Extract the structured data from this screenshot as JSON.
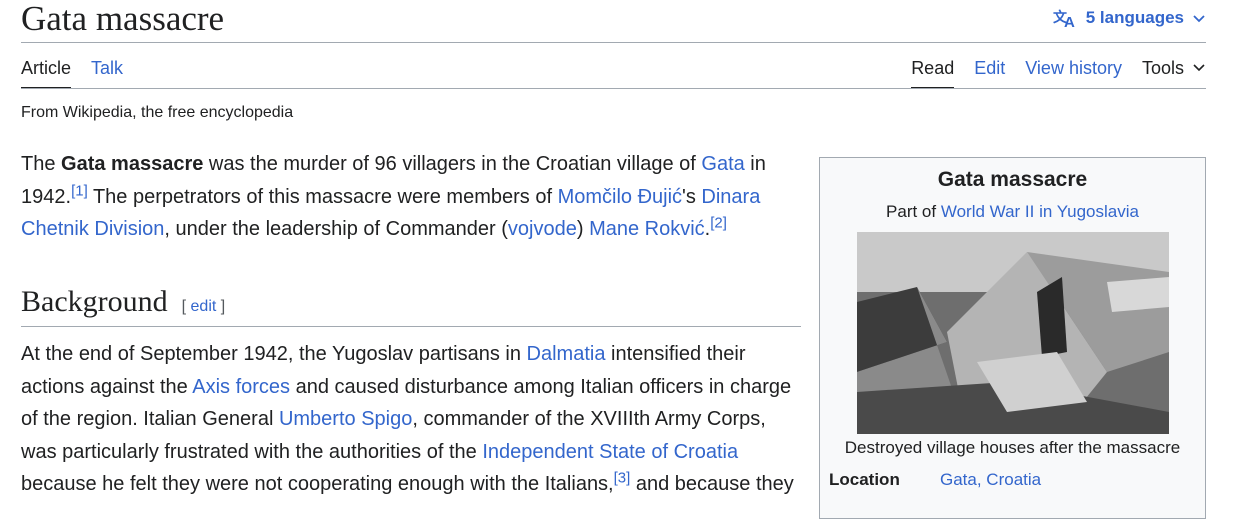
{
  "page": {
    "title": "Gata massacre",
    "languages_label": "5 languages",
    "tagline": "From Wikipedia, the free encyclopedia"
  },
  "tabs": {
    "article": "Article",
    "talk": "Talk",
    "read": "Read",
    "edit": "Edit",
    "view_history": "View history",
    "tools": "Tools"
  },
  "intro": {
    "t1": "The ",
    "bold": "Gata massacre",
    "t2": " was the murder of 96 villagers in the Croatian village of ",
    "link_gata": "Gata",
    "t3": " in 1942.",
    "ref1": "[1]",
    "t4": " The perpetrators of this massacre were members of ",
    "link_djujic": "Momčilo Đujić",
    "t5": "'s ",
    "link_dinara": "Dinara Chetnik Division",
    "t6": ", under the leadership of Commander (",
    "link_vojvode": "vojvode",
    "t7": ") ",
    "link_rokvic": "Mane Rokvić",
    "t8": ".",
    "ref2": "[2]"
  },
  "section": {
    "title": "Background",
    "edit_open": "[ ",
    "edit_label": "edit",
    "edit_close": " ]"
  },
  "background": {
    "t1": "At the end of September 1942, the Yugoslav partisans in ",
    "link_dalmatia": "Dalmatia",
    "t2": " intensified their actions against the ",
    "link_axis": "Axis forces",
    "t3": " and caused disturbance among Italian officers in charge of the region. Italian General ",
    "link_spigo": "Umberto Spigo",
    "t4": ", commander of the XVIIIth Army Corps, was particularly frustrated with the authorities of the ",
    "link_ndh": "Independent State of Croatia",
    "t5": " because he felt they were not cooperating enough with the Italians,",
    "ref3": "[3]",
    "t6": " and because they"
  },
  "infobox": {
    "title": "Gata massacre",
    "part_of_label": "Part of ",
    "part_of_link": "World War II in Yugoslavia",
    "caption": "Destroyed village houses after the massacre",
    "location_label": "Location",
    "location_value": "Gata, Croatia"
  }
}
